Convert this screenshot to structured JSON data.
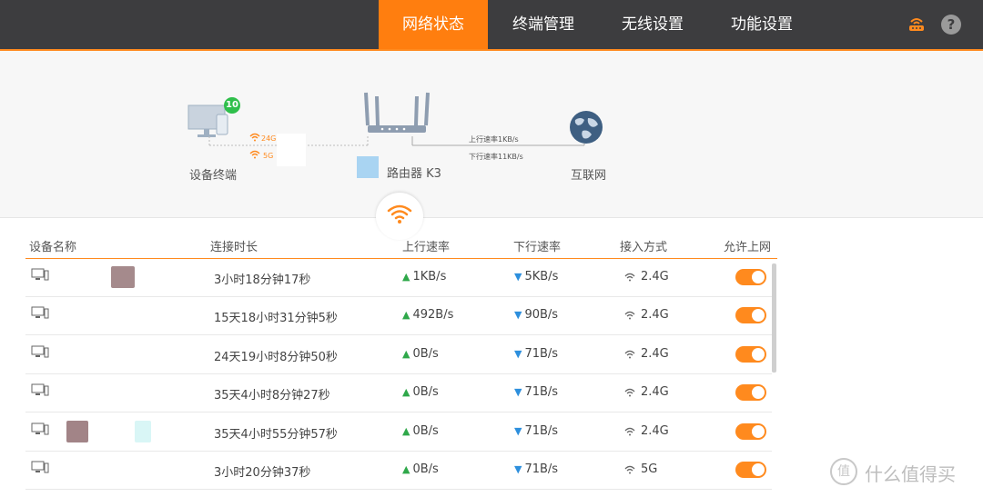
{
  "nav": {
    "tabs": [
      {
        "label": "网络状态",
        "active": true
      },
      {
        "label": "终端管理",
        "active": false
      },
      {
        "label": "无线设置",
        "active": false
      },
      {
        "label": "功能设置",
        "active": false
      }
    ],
    "router_icon": "router-icon",
    "help_icon": "help-icon",
    "help_symbol": "?"
  },
  "topology": {
    "devices_label": "设备终端",
    "device_count": "10",
    "band_24": "24G",
    "band_5": "5G",
    "router_label": "路由器 K3",
    "upload_rate": "上行速率1KB/s",
    "download_rate": "下行速率11KB/s",
    "internet_label": "互联网"
  },
  "table": {
    "headers": [
      "设备名称",
      "连接时长",
      "上行速率",
      "下行速率",
      "接入方式",
      "允许上网"
    ],
    "rows": [
      {
        "name": "",
        "duration": "3小时18分钟17秒",
        "up": "1KB/s",
        "down": "5KB/s",
        "access": "2.4G",
        "allowed": true
      },
      {
        "name": "",
        "duration": "15天18小时31分钟5秒",
        "up": "492B/s",
        "down": "90B/s",
        "access": "2.4G",
        "allowed": true
      },
      {
        "name": "",
        "duration": "24天19小时8分钟50秒",
        "up": "0B/s",
        "down": "71B/s",
        "access": "2.4G",
        "allowed": true
      },
      {
        "name": "",
        "duration": "35天4小时8分钟27秒",
        "up": "0B/s",
        "down": "71B/s",
        "access": "2.4G",
        "allowed": true
      },
      {
        "name": "",
        "duration": "35天4小时55分钟57秒",
        "up": "0B/s",
        "down": "71B/s",
        "access": "2.4G",
        "allowed": true
      },
      {
        "name": "",
        "duration": "3小时20分钟37秒",
        "up": "0B/s",
        "down": "71B/s",
        "access": "5G",
        "allowed": true
      }
    ]
  },
  "watermark": {
    "symbol": "值",
    "text": "什么值得买"
  },
  "colors": {
    "accent": "#ff7e0f",
    "topbar": "#3d3d3f",
    "up": "#2fa84a",
    "down": "#2d8fdd",
    "badge": "#2fbf4b"
  }
}
